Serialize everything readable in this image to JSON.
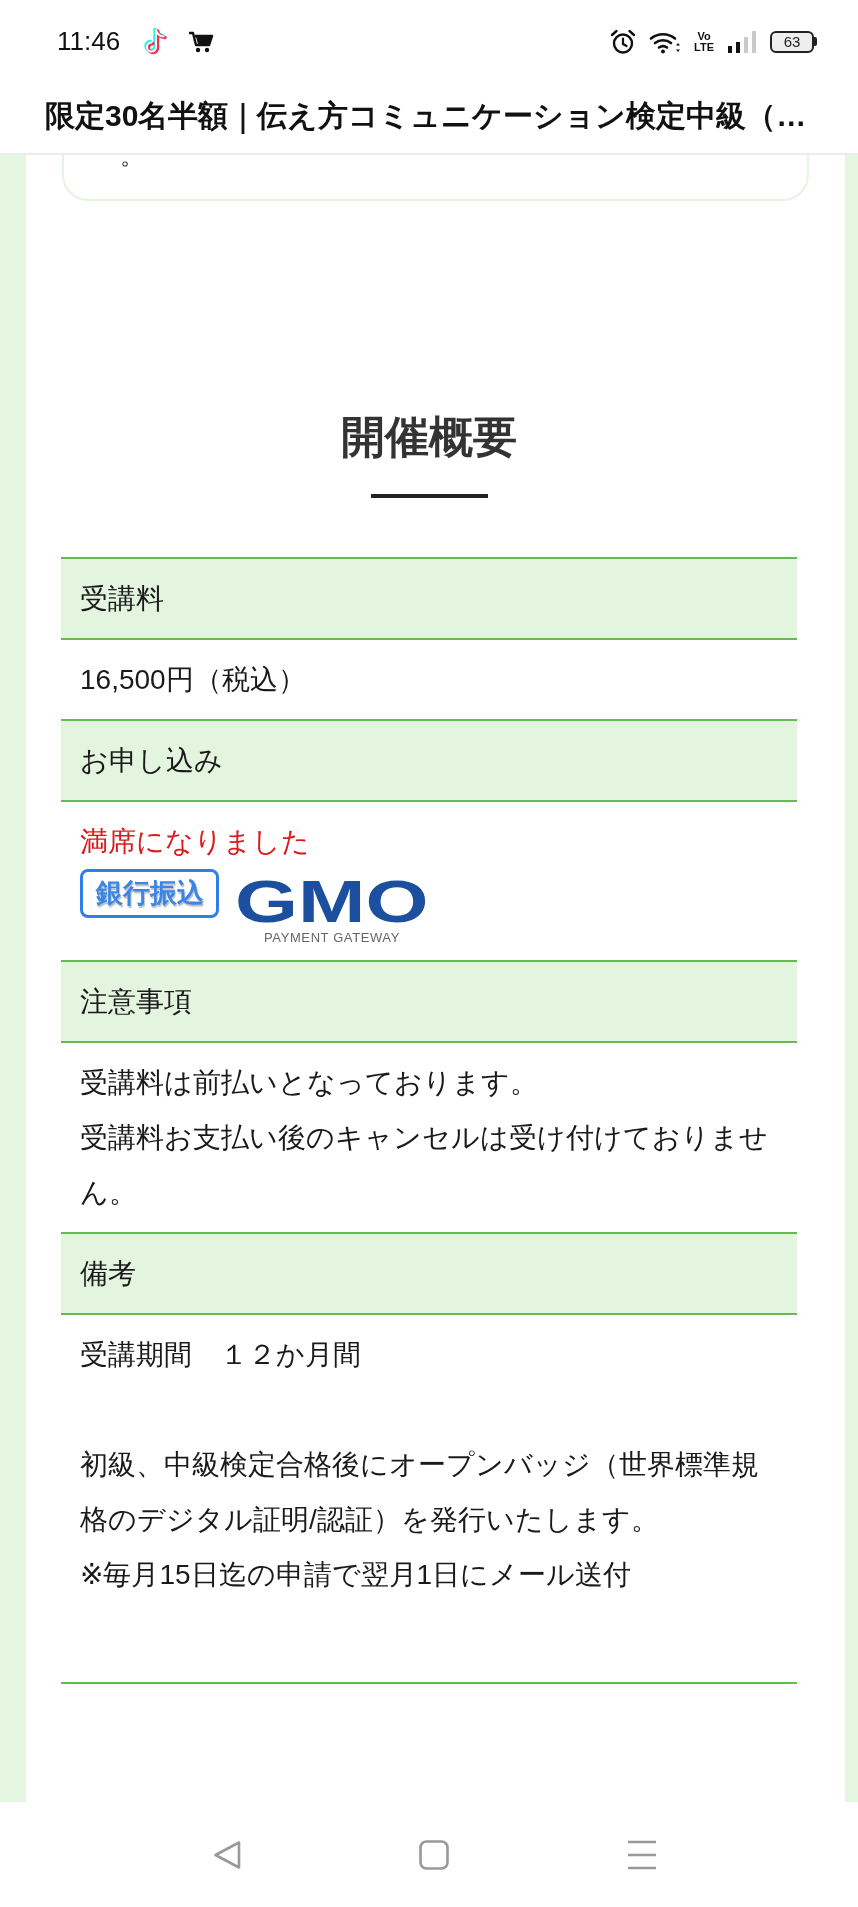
{
  "status_bar": {
    "time": "11:46",
    "network_type": "Vo\nLTE",
    "battery": "63"
  },
  "title_bar": {
    "title": "限定30名半額｜伝え方コミュニケーション検定中級（…"
  },
  "previous_card": {
    "text": "。"
  },
  "section": {
    "heading": "開催概要"
  },
  "table": {
    "rows": [
      {
        "kind": "header",
        "text": "受講料"
      },
      {
        "kind": "body",
        "paragraphs": [
          [
            "16,500円（税込）"
          ]
        ]
      },
      {
        "kind": "header",
        "text": "お申し込み"
      },
      {
        "kind": "application",
        "notice": "満席になりました",
        "payment_logos": [
          {
            "kind": "badge",
            "text": "銀行振込"
          },
          {
            "kind": "wordmark",
            "text": "GMO",
            "tagline": "PAYMENT GATEWAY"
          }
        ]
      },
      {
        "kind": "header",
        "text": "注意事項"
      },
      {
        "kind": "body",
        "paragraphs": [
          [
            "受講料は前払いとなっております。",
            "受講料お支払い後のキャンセルは受け付けておりません。"
          ]
        ]
      },
      {
        "kind": "header",
        "text": "備考"
      },
      {
        "kind": "body",
        "paragraphs": [
          [
            "受講期間　１２か月間"
          ],
          [
            "初級、中級検定合格後にオープンバッジ（世界標準規格のデジタル証明/認証）を発行いたします。",
            "※毎月15日迄の申請で翌月1日にメール送付"
          ]
        ]
      }
    ]
  }
}
